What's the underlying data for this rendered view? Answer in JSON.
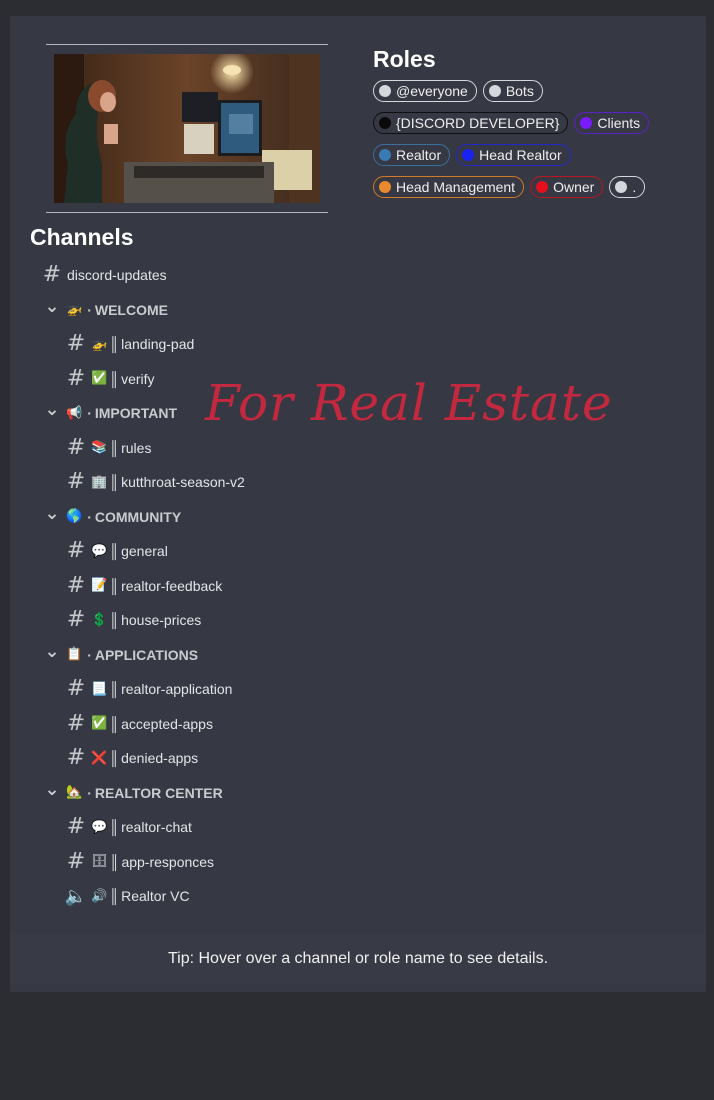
{
  "roles": {
    "title": "Roles",
    "rows": [
      [
        {
          "label": "@everyone",
          "color": "#d4d7dc",
          "border": "#d4d7dc"
        },
        {
          "label": "Bots",
          "color": "#d4d7dc",
          "border": "#d4d7dc"
        }
      ],
      [
        {
          "label": "{DISCORD DEVELOPER}",
          "color": "#0a0a0a",
          "border": "#0f0f12"
        },
        {
          "label": "Clients",
          "color": "#7b1cff",
          "border": "#5c20c9"
        }
      ],
      [
        {
          "label": "Realtor",
          "color": "#3a7bb4",
          "border": "#3a6f9e"
        },
        {
          "label": "Head Realtor",
          "color": "#1a22f2",
          "border": "#2127c9"
        }
      ],
      [
        {
          "label": "Head Management",
          "color": "#e88a2e",
          "border": "#d17a27"
        },
        {
          "label": "Owner",
          "color": "#e3101c",
          "border": "#b81620"
        },
        {
          "label": ".",
          "color": "#d4d7dc",
          "border": "#d4d7dc"
        }
      ]
    ]
  },
  "channels": {
    "title": "Channels",
    "items": [
      {
        "kind": "channel",
        "level": "top",
        "icon": "hash",
        "emoji": "",
        "name": "discord-updates"
      },
      {
        "kind": "category",
        "emoji": "🚁",
        "name": "WELCOME"
      },
      {
        "kind": "channel",
        "level": "sub",
        "icon": "hash",
        "emoji": "🚁",
        "name": "landing-pad"
      },
      {
        "kind": "channel",
        "level": "sub",
        "icon": "hash",
        "emoji": "✅",
        "name": "verify"
      },
      {
        "kind": "category",
        "emoji": "📢",
        "name": "IMPORTANT"
      },
      {
        "kind": "channel",
        "level": "sub",
        "icon": "hash",
        "emoji": "📚",
        "name": "rules"
      },
      {
        "kind": "channel",
        "level": "sub",
        "icon": "hash",
        "emoji": "🏢",
        "name": "kutthroat-season-v2"
      },
      {
        "kind": "category",
        "emoji": "🌎",
        "name": "COMMUNITY"
      },
      {
        "kind": "channel",
        "level": "sub",
        "icon": "hash",
        "emoji": "💬",
        "name": "general"
      },
      {
        "kind": "channel",
        "level": "sub",
        "icon": "hash",
        "emoji": "📝",
        "name": "realtor-feedback"
      },
      {
        "kind": "channel",
        "level": "sub",
        "icon": "hash",
        "emoji": "💲",
        "name": "house-prices"
      },
      {
        "kind": "category",
        "emoji": "📋",
        "name": "APPLICATIONS"
      },
      {
        "kind": "channel",
        "level": "sub",
        "icon": "hash",
        "emoji": "📃",
        "name": "realtor-application"
      },
      {
        "kind": "channel",
        "level": "sub",
        "icon": "hash",
        "emoji": "✅",
        "name": "accepted-apps"
      },
      {
        "kind": "channel",
        "level": "sub",
        "icon": "hash",
        "emoji": "❌",
        "name": "denied-apps"
      },
      {
        "kind": "category",
        "emoji": "🏡",
        "name": "REALTOR CENTER"
      },
      {
        "kind": "channel",
        "level": "sub",
        "icon": "hash",
        "emoji": "💬",
        "name": "realtor-chat"
      },
      {
        "kind": "channel",
        "level": "sub",
        "icon": "hash",
        "emoji": "🗄",
        "name": "app-responces"
      },
      {
        "kind": "channel",
        "level": "sub",
        "icon": "speaker",
        "emoji": "🔊",
        "name": "Realtor VC"
      }
    ]
  },
  "separators": {
    "category": "·",
    "channel": "║"
  },
  "watermark": "For Real Estate",
  "tip": "Tip: Hover over a channel or role name to see details."
}
